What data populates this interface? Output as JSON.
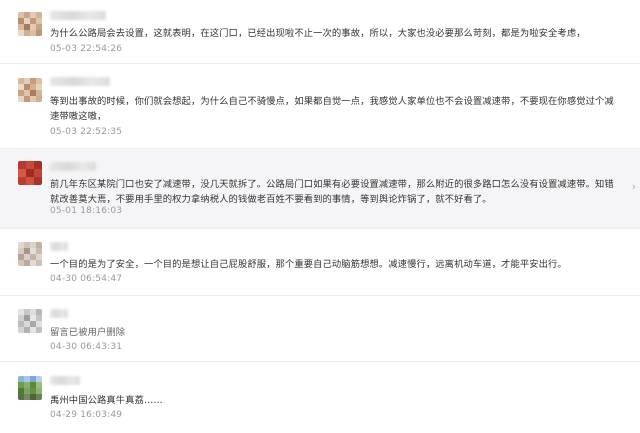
{
  "comments": [
    {
      "text": "为什么公路局会去设置，这就表明，在这门口，已经出现啦不止一次的事故，所以，大家也没必要那么苛刻，都是为啦安全考虑，",
      "time": "05-03 22:54:26"
    },
    {
      "text": "等到出事故的时候，你们就会想起，为什么自己不骑慢点，如果都自觉一点，我感觉人家单位也不会设置减速带，不要现在你感觉过个减速带嗷这嗷，",
      "time": "05-03 22:52:35"
    },
    {
      "text": "前几年东区某院门口也安了减速带，没几天就拆了。公路局门口如果有必要设置减速带，那么附近的很多路口怎么没有设置减速带。知错就改善莫大焉，不要用手里的权力拿纳税人的钱做老百姓不要看到的事情，等到舆论炸锅了，就不好看了。",
      "time": "05-01 18:16:03",
      "collapse_icon": "chevron-right-icon"
    },
    {
      "text": "一个目的是为了安全，一个目的是想让自己屁股舒服，那个重要自己动脑筋想想。减速慢行，远离机动车道，才能平安出行。",
      "time": "04-30 06:54:47"
    },
    {
      "text": "留言已被用户删除",
      "time": "04-30 06:43:31"
    },
    {
      "text": "禹州中国公路真牛真荔……",
      "time": "04-29 16:03:49"
    }
  ],
  "colors": {
    "text": "#333333",
    "timestamp": "#9a9a9a",
    "highlight_bg": "#f5f5f7",
    "divider": "#ececec"
  }
}
